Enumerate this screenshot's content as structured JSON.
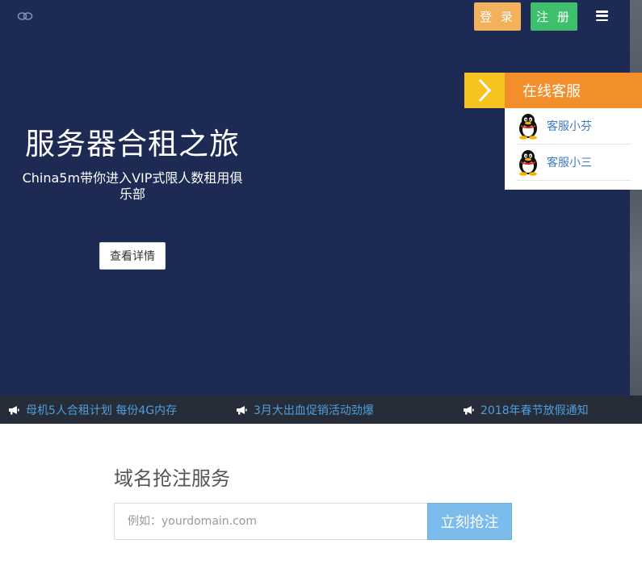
{
  "header": {
    "logo_icon": "cloud-link-icon",
    "login_label": "登 录",
    "register_label": "注 册",
    "menu_icon": "hamburger-menu-icon"
  },
  "hero": {
    "title": "服务器合租之旅",
    "subtitle": "China5m带你进入VIP式限人数租用俱乐部",
    "detail_button": "查看详情"
  },
  "customer_service": {
    "toggle_icon": "chevron-right-icon",
    "title": "在线客服",
    "agents": [
      {
        "name": "客服小芬",
        "icon": "qq-penguin-icon"
      },
      {
        "name": "客服小三",
        "icon": "qq-penguin-icon"
      }
    ]
  },
  "notices": [
    {
      "text": "母机5人合租计划 每份4G内存",
      "icon": "megaphone-icon"
    },
    {
      "text": "3月大出血促销活动劲爆",
      "icon": "megaphone-icon"
    },
    {
      "text": "2018年春节放假通知",
      "icon": "megaphone-icon"
    }
  ],
  "domain": {
    "title": "域名抢注服务",
    "placeholder": "例如：yourdomain.com",
    "value": "",
    "button_label": "立刻抢注"
  },
  "colors": {
    "hero_bg": "#1c2a54",
    "login": "#f2b15a",
    "register": "#3dbf6c",
    "cs_header": "#f28f2a",
    "cs_toggle": "#f7c31e",
    "notice_bg": "#262d38",
    "notice_text": "#4e9fdc",
    "domain_button": "#7cbcec"
  }
}
